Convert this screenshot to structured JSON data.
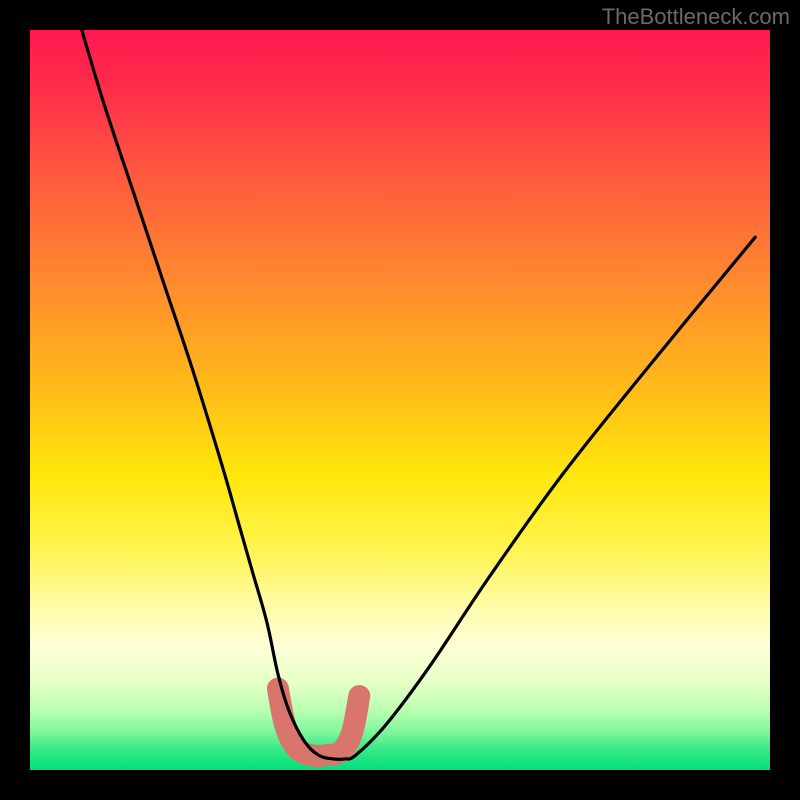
{
  "watermark": "TheBottleneck.com",
  "chart_data": {
    "type": "line",
    "title": "",
    "xlabel": "",
    "ylabel": "",
    "xlim": [
      0,
      100
    ],
    "ylim": [
      0,
      100
    ],
    "grid": false,
    "series": [
      {
        "name": "bottleneck-curve",
        "x": [
          7,
          10,
          14,
          18,
          22,
          26,
          28,
          30,
          32,
          33.5,
          35,
          37,
          39,
          41,
          42.5,
          44,
          48,
          54,
          62,
          72,
          84,
          98
        ],
        "values": [
          100,
          90,
          78,
          66,
          54,
          41,
          34,
          27,
          20,
          13,
          8,
          4,
          2,
          1.5,
          1.5,
          2,
          6,
          14,
          26,
          40,
          55,
          72
        ]
      },
      {
        "name": "optimal-band",
        "x": [
          33.5,
          34.5,
          36,
          38,
          40,
          42,
          43.5,
          44.5
        ],
        "values": [
          11,
          6,
          3,
          2,
          2,
          2.5,
          5,
          10
        ]
      }
    ],
    "flat_bottom": {
      "x": [
        36,
        42.5
      ],
      "y": 1.6
    },
    "colors": {
      "curve": "#000000",
      "band": "#d8766e"
    }
  }
}
